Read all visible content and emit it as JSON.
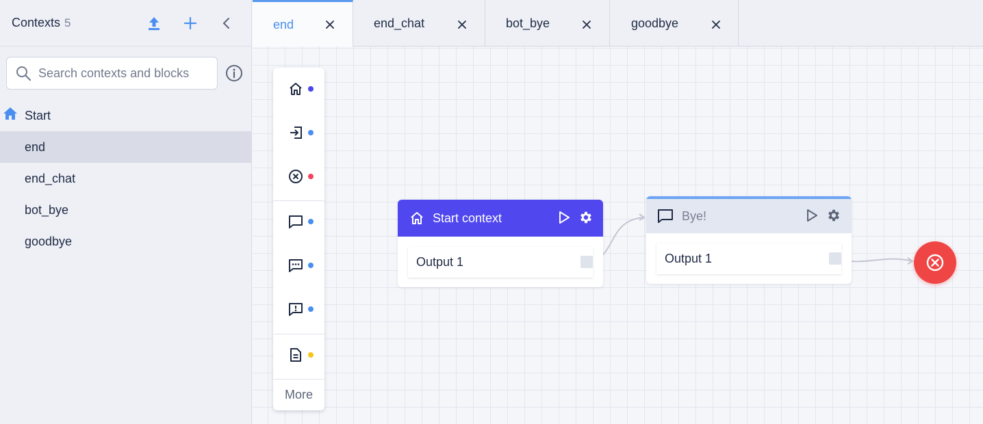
{
  "sidebar": {
    "title": "Contexts",
    "count": "5",
    "search": {
      "placeholder": "Search contexts and blocks",
      "value": ""
    },
    "items": [
      {
        "label": "Start",
        "icon": "home-icon",
        "active": false
      },
      {
        "label": "end",
        "active": true
      },
      {
        "label": "end_chat",
        "active": false
      },
      {
        "label": "bot_bye",
        "active": false
      },
      {
        "label": "goodbye",
        "active": false
      }
    ]
  },
  "tabs": [
    {
      "label": "end",
      "active": true
    },
    {
      "label": "end_chat",
      "active": false
    },
    {
      "label": "bot_bye",
      "active": false
    },
    {
      "label": "goodbye",
      "active": false
    }
  ],
  "palette": {
    "items": [
      {
        "icon": "home-icon",
        "dot_color": "#4a47e8"
      },
      {
        "icon": "enter-icon",
        "dot_color": "#4a8ff0"
      },
      {
        "icon": "close-circle-icon",
        "dot_color": "#f04560"
      },
      {
        "icon": "chat-icon",
        "dot_color": "#4a8ff0"
      },
      {
        "icon": "chat-dots-icon",
        "dot_color": "#4a8ff0"
      },
      {
        "icon": "chat-alert-icon",
        "dot_color": "#4a8ff0"
      },
      {
        "icon": "document-icon",
        "dot_color": "#f5c518"
      }
    ],
    "more_label": "More"
  },
  "canvas": {
    "start_block": {
      "title": "Start context",
      "output": "Output 1",
      "color": "#5047ee"
    },
    "bye_block": {
      "title": "Bye!",
      "output": "Output 1",
      "accent": "#6aa4f5"
    },
    "end_node": {
      "color": "#f04545",
      "icon": "close-circle-icon"
    }
  },
  "colors": {
    "accent": "#4a8ff0",
    "brand": "#5047ee",
    "danger": "#f04545"
  }
}
